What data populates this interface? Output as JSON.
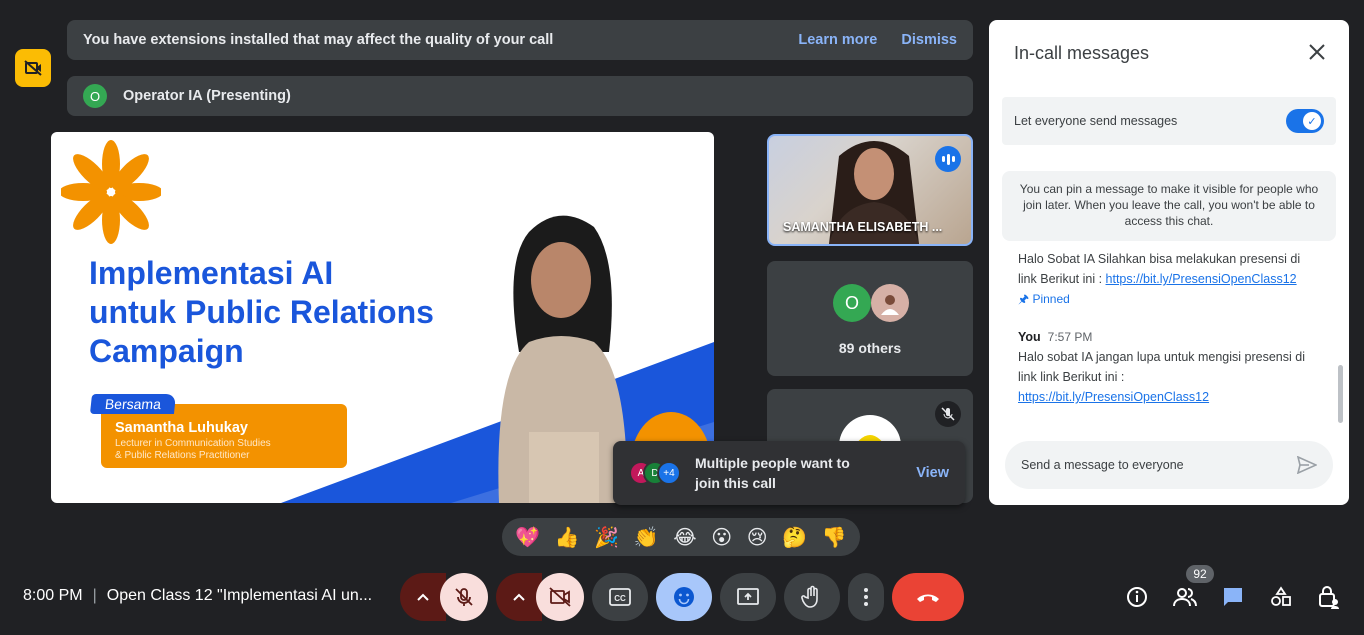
{
  "banner": {
    "text": "You have extensions installed that may affect the quality of your call",
    "learn_more": "Learn more",
    "dismiss": "Dismiss"
  },
  "presenter": {
    "initial": "O",
    "label": "Operator IA (Presenting)"
  },
  "slide": {
    "title_line1": "Implementasi  AI",
    "title_line2": "untuk Public Relations",
    "title_line3": "Campaign",
    "tag": "Bersama",
    "name": "Samantha Luhukay",
    "desc_line1": "Lecturer in Communication Studies",
    "desc_line2": "& Public Relations Practitioner"
  },
  "tiles": {
    "speaker_name": "SAMANTHA ELISABETH ...",
    "others_initial": "O",
    "others_count": "89 others"
  },
  "toast": {
    "avatars": [
      "A",
      "D",
      "+4"
    ],
    "line1": "Multiple people want to",
    "line2": "join this call",
    "view": "View"
  },
  "chat": {
    "title": "In-call messages",
    "toggle_label": "Let everyone send messages",
    "info": "You can pin a message to make it visible for people who join later. When you leave the call, you won't be able to access this chat.",
    "msg1_text": "Halo Sobat IA Silahkan bisa melakukan presensi di link Berikut ini : ",
    "msg1_link": "https://bit.ly/PresensiOpenClass12",
    "pinned": "Pinned",
    "msg2_sender": "You",
    "msg2_time": "7:57 PM",
    "msg2_text": "Halo sobat IA jangan lupa untuk mengisi presensi di link link Berikut ini :",
    "msg2_link": "https://bit.ly/PresensiOpenClass12",
    "input_placeholder": "Send a message to everyone"
  },
  "reactions": [
    "💖",
    "👍",
    "🎉",
    "👏",
    "😂",
    "😮",
    "😢",
    "🤔",
    "👎"
  ],
  "bottom": {
    "time": "8:00 PM",
    "separator": "|",
    "meeting_title": "Open Class 12 \"Implementasi AI un...",
    "participants_badge": "92"
  },
  "colors": {
    "accent": "#8ab4f8",
    "end_call": "#ea4335",
    "mic_off_bg": "#f9dedc",
    "dark_red": "#5c1a16",
    "panel_bg": "#ffffff"
  }
}
